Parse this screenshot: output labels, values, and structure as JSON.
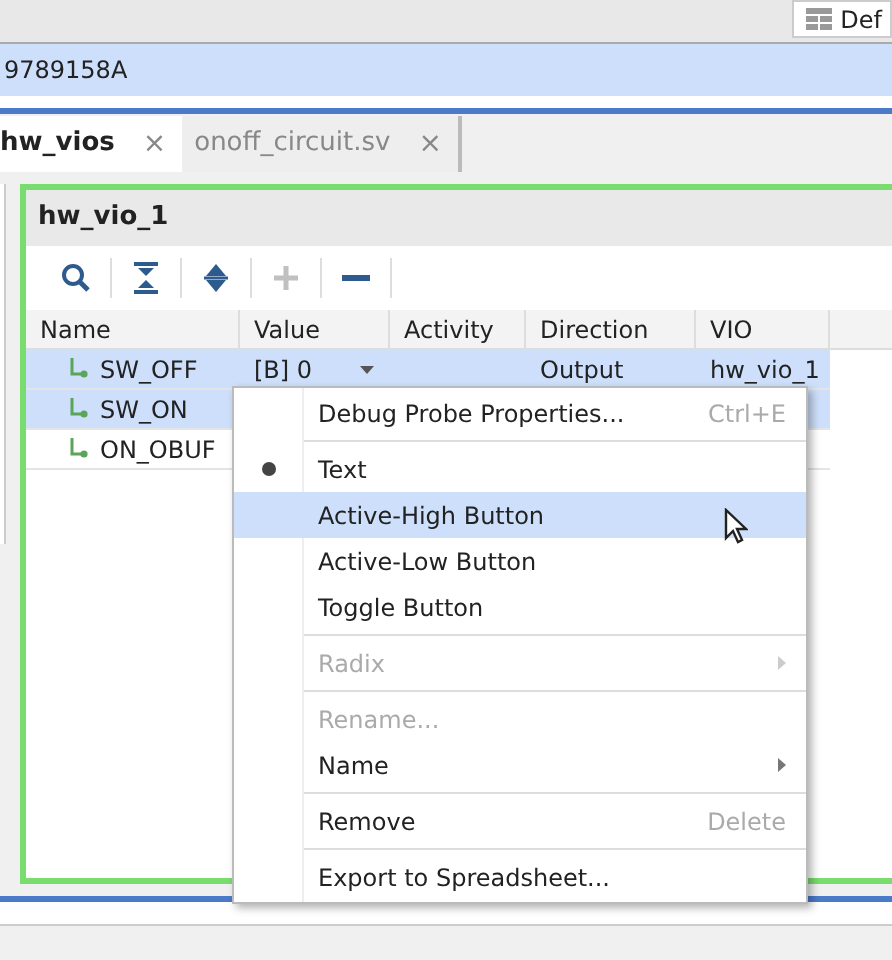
{
  "top_bar": {
    "layout_button": "Def"
  },
  "device_row": {
    "text": "9789158A"
  },
  "tabs": [
    {
      "label": "hw_vios",
      "selected": true,
      "close": "×"
    },
    {
      "label": "onoff_circuit.sv",
      "selected": false,
      "close": "×"
    }
  ],
  "panel": {
    "title": "hw_vio_1",
    "toolbar": [
      {
        "kind": "search",
        "disabled": false
      },
      {
        "kind": "collapse",
        "disabled": false
      },
      {
        "kind": "expand",
        "disabled": false
      },
      {
        "kind": "add",
        "disabled": true
      },
      {
        "kind": "remove",
        "disabled": false
      }
    ],
    "table": {
      "columns": [
        "Name",
        "Value",
        "Activity",
        "Direction",
        "VIO"
      ],
      "rows": [
        {
          "name": "SW_OFF",
          "value": "[B] 0",
          "direction": "Output",
          "vio": "hw_vio_1",
          "selected": true
        },
        {
          "name": "SW_ON",
          "selected": true
        },
        {
          "name": "ON_OBUF",
          "selected": false
        }
      ]
    }
  },
  "context_menu": [
    {
      "kind": "action",
      "label": "Debug Probe Properties...",
      "shortcut": "Ctrl+E",
      "disabled": false,
      "highlighted": false,
      "separator_before": false
    },
    {
      "kind": "radio",
      "label": "Text",
      "checked": true,
      "disabled": false,
      "highlighted": false,
      "separator_before": true
    },
    {
      "kind": "radio",
      "label": "Active-High Button",
      "checked": false,
      "disabled": false,
      "highlighted": true,
      "separator_before": false
    },
    {
      "kind": "radio",
      "label": "Active-Low Button",
      "checked": false,
      "disabled": false,
      "highlighted": false,
      "separator_before": false
    },
    {
      "kind": "radio",
      "label": "Toggle Button",
      "checked": false,
      "disabled": false,
      "highlighted": false,
      "separator_before": false
    },
    {
      "kind": "submenu",
      "label": "Radix",
      "disabled": true,
      "highlighted": false,
      "separator_before": true
    },
    {
      "kind": "action",
      "label": "Rename...",
      "disabled": true,
      "highlighted": false,
      "separator_before": true
    },
    {
      "kind": "submenu",
      "label": "Name",
      "disabled": false,
      "highlighted": false,
      "separator_before": false
    },
    {
      "kind": "action",
      "label": "Remove",
      "shortcut": "Delete",
      "disabled": false,
      "highlighted": false,
      "separator_before": true
    },
    {
      "kind": "action",
      "label": "Export to Spreadsheet...",
      "disabled": false,
      "highlighted": false,
      "separator_before": true
    }
  ]
}
